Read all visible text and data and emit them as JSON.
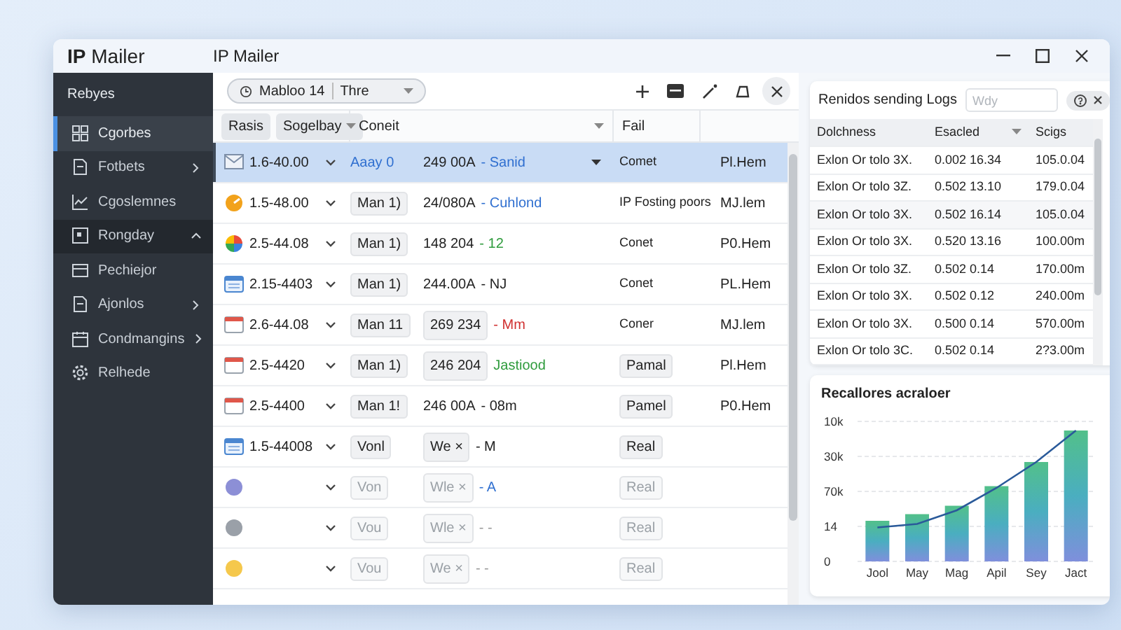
{
  "app": {
    "brand": "**IP** Mailer",
    "title": "IP Mailer"
  },
  "sidebar": {
    "heading": "Rebyes",
    "items": [
      {
        "label": "Cgorbes",
        "selected": true
      },
      {
        "label": "Fotbets",
        "selected": false,
        "expanded": false
      },
      {
        "label": "Cgoslemnes",
        "selected": false
      },
      {
        "label": "Rongday",
        "selected": false,
        "expanded": true
      },
      {
        "label": "Pechiejor",
        "selected": false
      },
      {
        "label": "Ajonlos",
        "selected": false,
        "expanded": false
      },
      {
        "label": "Condmangins",
        "selected": false,
        "expanded": false
      },
      {
        "label": "Relhede",
        "selected": false
      }
    ]
  },
  "toolbar": {
    "filter": "Mabloo 14",
    "filter_value": "Thre"
  },
  "table": {
    "header_buttons": [
      {
        "label": "Rasis",
        "dropdown": false
      },
      {
        "label": "Sogelbay",
        "dropdown": true
      }
    ],
    "columns": [
      {
        "label": "Coneit",
        "dropdown": true
      },
      {
        "label": "Fail",
        "dropdown": false
      }
    ],
    "rows": [
      {
        "kind": "mail",
        "date": "1.6-40.00",
        "col2": {
          "text": "Aaay 0",
          "boxed": false
        },
        "amount": {
          "text": "249 00A",
          "boxed": false
        },
        "tag": {
          "text": "- Sanid",
          "color": "#2f6fd0"
        },
        "dropdown": true,
        "col5": {
          "text": "Comet",
          "boxed": false
        },
        "col6": "Pl.Hem",
        "selected": true,
        "dimmed": false
      },
      {
        "kind": "orange",
        "date": "1.5-48.00",
        "col2": {
          "text": "Man 1)",
          "boxed": true
        },
        "amount": {
          "text": "24/080A",
          "boxed": false
        },
        "tag": {
          "text": "- Cuhlond",
          "color": "#2f6fd0"
        },
        "dropdown": false,
        "col5": {
          "text": "IP Fosting poors",
          "boxed": false
        },
        "col6": "MJ.lem",
        "selected": false,
        "dimmed": false
      },
      {
        "kind": "pie",
        "date": "2.5-44.08",
        "col2": {
          "text": "Man 1)",
          "boxed": true
        },
        "amount": {
          "text": "148 204",
          "boxed": false
        },
        "tag": {
          "text": "- 12",
          "color": "#2e9b3c"
        },
        "dropdown": false,
        "col5": {
          "text": "Conet",
          "boxed": false
        },
        "col6": "P0.Hem",
        "selected": false,
        "dimmed": false
      },
      {
        "kind": "calendar-blue",
        "date": "2.15-4403",
        "col2": {
          "text": "Man 1)",
          "boxed": true
        },
        "amount": {
          "text": "244.00A",
          "boxed": false
        },
        "tag": {
          "text": "- NJ",
          "color": "#222222"
        },
        "dropdown": false,
        "col5": {
          "text": "Conet",
          "boxed": false
        },
        "col6": "PL.Hem",
        "selected": false,
        "dimmed": false
      },
      {
        "kind": "calendar-red",
        "date": "2.6-44.08",
        "col2": {
          "text": "Man 11",
          "boxed": true
        },
        "amount": {
          "text": "269 234",
          "boxed": true
        },
        "tag": {
          "text": "- Mm",
          "color": "#d03030"
        },
        "dropdown": false,
        "col5": {
          "text": "Coner",
          "boxed": false
        },
        "col6": "MJ.lem",
        "selected": false,
        "dimmed": false
      },
      {
        "kind": "calendar-red",
        "date": "2.5-4420",
        "col2": {
          "text": "Man 1)",
          "boxed": true
        },
        "amount": {
          "text": "246 204",
          "boxed": true
        },
        "tag": {
          "text": "Jastiood",
          "color": "#2e9b3c"
        },
        "dropdown": false,
        "col5": {
          "text": "Pamal",
          "boxed": true
        },
        "col6": "Pl.Hem",
        "selected": false,
        "dimmed": false
      },
      {
        "kind": "calendar-red",
        "date": "2.5-4400",
        "col2": {
          "text": "Man 1!",
          "boxed": true
        },
        "amount": {
          "text": "246 00A",
          "boxed": false
        },
        "tag": {
          "text": "- 08m",
          "color": "#222222"
        },
        "dropdown": false,
        "col5": {
          "text": "Pamel",
          "boxed": true
        },
        "col6": "P0.Hem",
        "selected": false,
        "dimmed": false
      },
      {
        "kind": "calendar-blue",
        "date": "1.5-44008",
        "col2": {
          "text": "Vonl",
          "boxed": true
        },
        "amount": {
          "text": "We ×",
          "boxed": true
        },
        "tag": {
          "text": "- M",
          "color": "#222222"
        },
        "dropdown": false,
        "col5": {
          "text": "Real",
          "boxed": true
        },
        "selected": false,
        "dimmed": false
      },
      {
        "kind": "purple",
        "col2": {
          "text": "Von",
          "boxed": true
        },
        "amount": {
          "text": "Wle ×",
          "boxed": true
        },
        "tag": {
          "text": "- A",
          "color": "#2f6fd0"
        },
        "dropdown": false,
        "col5": {
          "text": "Real",
          "boxed": true
        },
        "selected": false,
        "dimmed": true
      },
      {
        "kind": "gray",
        "col2": {
          "text": "Vou",
          "boxed": true
        },
        "amount": {
          "text": "Wle ×",
          "boxed": true
        },
        "tag": {
          "text": "- -",
          "color": "#999999"
        },
        "dropdown": false,
        "col5": {
          "text": "Real",
          "boxed": true
        },
        "selected": false,
        "dimmed": true
      },
      {
        "kind": "yellow",
        "col2": {
          "text": "Vou",
          "boxed": true
        },
        "amount": {
          "text": "We ×",
          "boxed": true
        },
        "tag": {
          "text": "- -",
          "color": "#999999"
        },
        "dropdown": false,
        "col5": {
          "text": "Real",
          "boxed": true
        },
        "selected": false,
        "dimmed": true
      }
    ]
  },
  "logs": {
    "title": "Renidos sending Logs",
    "search": {
      "placeholder": "Wdy"
    },
    "columns": [
      {
        "label": "Dolchness",
        "dropdown": false
      },
      {
        "label": "Esacled",
        "dropdown": true
      },
      {
        "label": "Scigs",
        "dropdown": false
      }
    ],
    "rows": [
      [
        "Exlon Or tolo 3X.",
        "0.002 16.34",
        "105.0.04"
      ],
      [
        "Exlon Or tolo 3Z.",
        "0.502 13.10",
        "179.0.04"
      ],
      [
        "Exlon Or tolo 3X.",
        "0.502 16.14",
        "105.0.04"
      ],
      [
        "Exlon Or tolo 3X.",
        "0.520 13.16",
        "100.00m"
      ],
      [
        "Exlon Or tolo 3Z.",
        "0.502 0.14",
        "170.00m"
      ],
      [
        "Exlon Or tolo 3X.",
        "0.502 0.12",
        "240.00m"
      ],
      [
        "Exlon Or tolo 3X.",
        "0.500 0.14",
        "570.00m"
      ],
      [
        "Exlon Or tolo 3C.",
        "0.502 0.14",
        "2?3.00m"
      ]
    ]
  },
  "chart_card": {
    "title": "Recallores acraloer",
    "y_labels": [
      "10k",
      "30k",
      "70k",
      "14",
      "0"
    ],
    "x_labels": [
      "Jool",
      "May",
      "Mag",
      "Apil",
      "Sey",
      "Jact"
    ]
  }
}
